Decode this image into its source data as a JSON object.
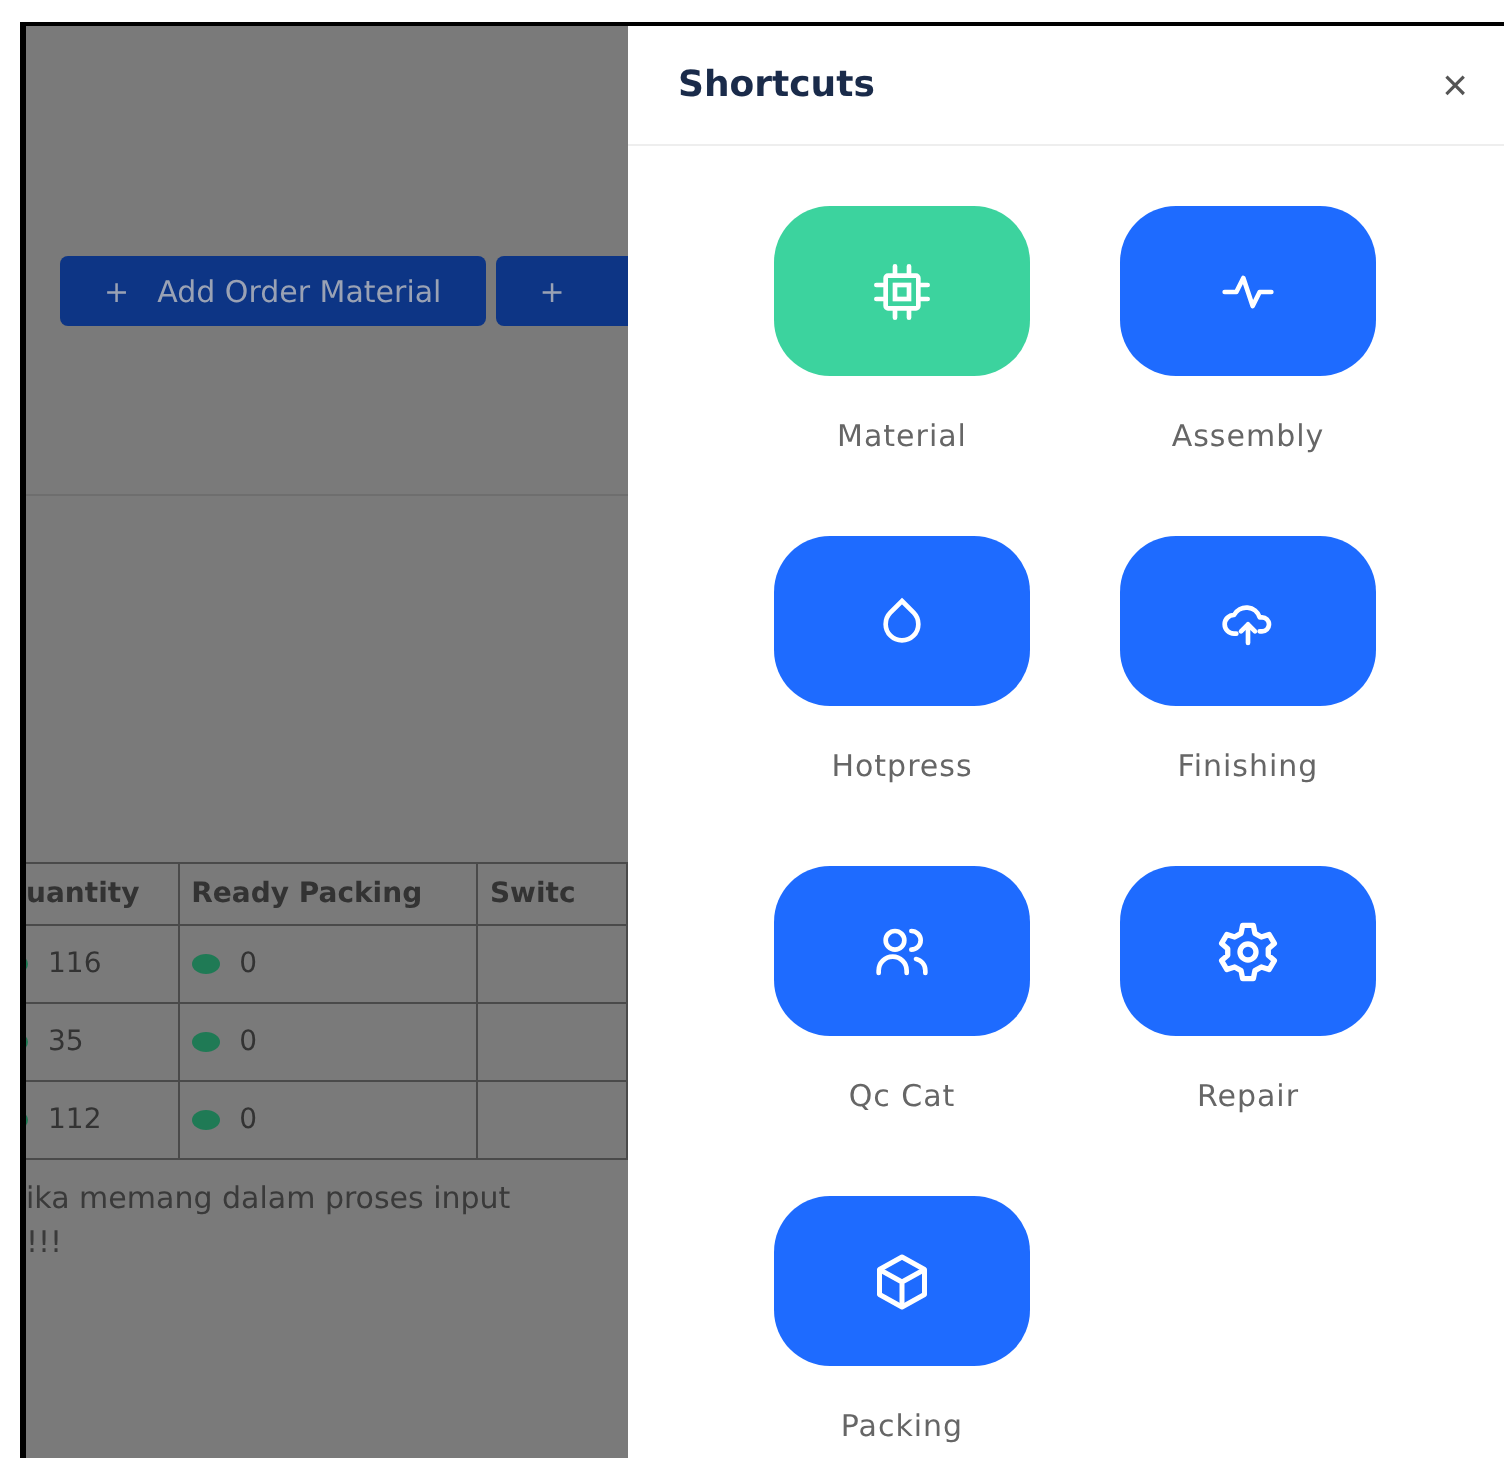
{
  "background_page": {
    "buttons": [
      {
        "icon": "+",
        "label": "Add Order Material"
      },
      {
        "icon": "+"
      }
    ],
    "table": {
      "columns": [
        "uantity",
        "Ready Packing",
        "Switc"
      ],
      "rows": [
        [
          "116",
          "0"
        ],
        [
          "35",
          "0"
        ],
        [
          "112",
          "0"
        ]
      ]
    },
    "note_lines": [
      "ika memang dalam proses input",
      "!!!"
    ]
  },
  "panel": {
    "title": "Shortcuts",
    "close": "×",
    "shortcuts": [
      {
        "label": "Material",
        "color": "#3cd39e"
      },
      {
        "label": "Assembly",
        "color": "#1e6bff"
      },
      {
        "label": "Hotpress",
        "color": "#1e6bff"
      },
      {
        "label": "Finishing",
        "color": "#1e6bff"
      },
      {
        "label": "Qc Cat",
        "color": "#1e6bff"
      },
      {
        "label": "Repair",
        "color": "#1e6bff"
      },
      {
        "label": "Packing",
        "color": "#1e6bff"
      }
    ]
  }
}
